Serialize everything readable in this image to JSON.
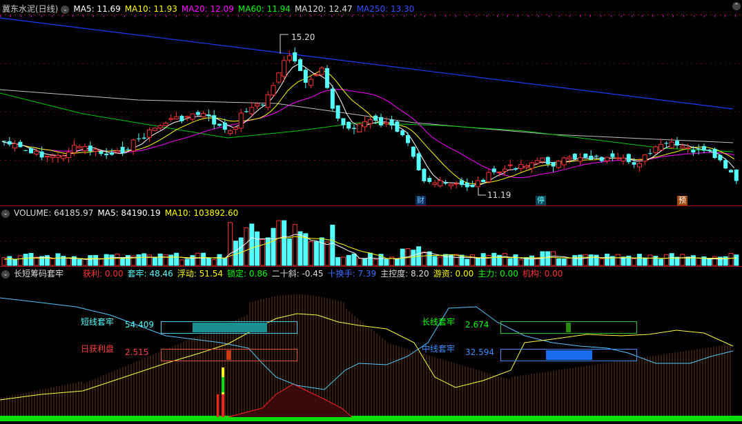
{
  "price_header": {
    "stock_name": "冀东水泥(日线)",
    "ma5": "MA5: 11.69",
    "ma10": "MA10: 11.93",
    "ma20": "MA20: 12.09",
    "ma60": "MA60: 11.94",
    "ma120": "MA120: 12.47",
    "ma250": "MA250: 13.30"
  },
  "price_annotations": {
    "high": "15.20",
    "low": "11.19"
  },
  "event_marks": [
    "财",
    "停",
    "预"
  ],
  "volume_header": {
    "volume": "VOLUME: 64185.97",
    "ma5": "MA5: 84190.19",
    "ma10": "MA10: 103892.60"
  },
  "indicator_header": {
    "name": "长短筹码套牢",
    "profit": "获利: 0.00",
    "trapped": "套牢: 48.46",
    "floating": "浮动: 51.54",
    "locked": "锁定: 0.86",
    "slope20": "二十斜: -0.45",
    "turnover10": "十换手: 7.39",
    "control": "主控度: 8.20",
    "retail": "游资: 0.00",
    "main_force": "主力: 0.00",
    "institution": "机构: 0.00"
  },
  "boxes": {
    "short_trapped": {
      "label": "短线套牢",
      "value": "54.409",
      "fraction": 0.544
    },
    "daily_profit": {
      "label": "日获利盘",
      "value": "2.515",
      "fraction": 0.025
    },
    "long_trapped": {
      "label": "长线套牢",
      "value": "2.674",
      "fraction": 0.027
    },
    "mid_trapped": {
      "label": "中线套牢",
      "value": "32.594",
      "fraction": 0.326
    }
  },
  "colors": {
    "up": "#ff3232",
    "down": "#54ffff",
    "ma5": "#ffffff",
    "ma10": "#ffff00",
    "ma20": "#ff00ff",
    "ma60": "#00cc00",
    "ma120": "#c0c0c0",
    "ma250": "#1a3cff",
    "grid": "#a01010"
  },
  "icons": [
    "collapse-circle-icon",
    "corner-circle-icon"
  ]
}
